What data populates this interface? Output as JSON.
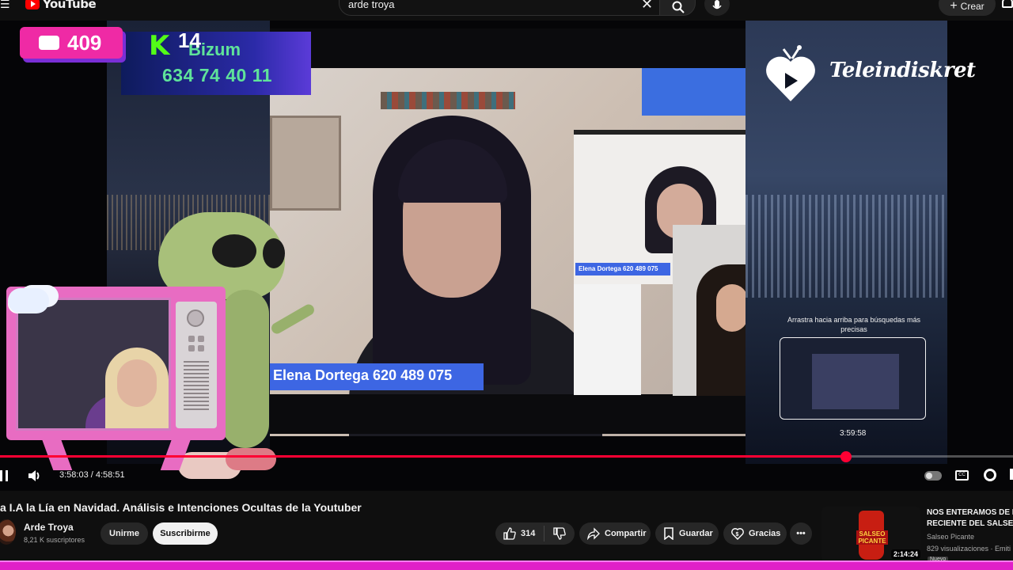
{
  "topbar": {
    "logo_text": "YouTube",
    "search_query": "arde troya",
    "create_label": "Crear"
  },
  "overlay": {
    "chat_count": "409",
    "kick_count": "14",
    "bizum_label": "Bizum",
    "bizum_number": "634 74 40 11",
    "brand_text": "Teleindiskret",
    "main_name_tag": "Elena Dortega 620 489 075",
    "sub_name_tag": "Elena Dortega 620 489 075"
  },
  "player": {
    "seek_hint": "Arrastra hacia arriba para búsquedas más precisas",
    "preview_time": "3:59:58",
    "current_time": "3:58:03",
    "total_time": "4:58:51",
    "time_display": "3:58:03 / 4:58:51",
    "progress_fraction": 0.835,
    "accent_color": "#ff0033"
  },
  "video": {
    "title": "a I.A la Lía en Navidad. Análisis e Intenciones Ocultas de la Youtuber",
    "channel_name": "Arde Troya",
    "subscribers": "8,21 K suscriptores",
    "join_label": "Unirme",
    "subscribe_label": "Suscribirme",
    "likes": "314",
    "share_label": "Compartir",
    "save_label": "Guardar",
    "thanks_label": "Gracias"
  },
  "recommendation": {
    "title_line1": "NOS ENTERAMOS DE L",
    "title_line2": "RECIENTE DEL SALSEO",
    "thumb_label": "SALSEO PICANTE",
    "duration": "2:14:24",
    "channel": "Salseo Picante",
    "views": "829 visualizaciones · Emiti",
    "badge": "Nuevo"
  }
}
